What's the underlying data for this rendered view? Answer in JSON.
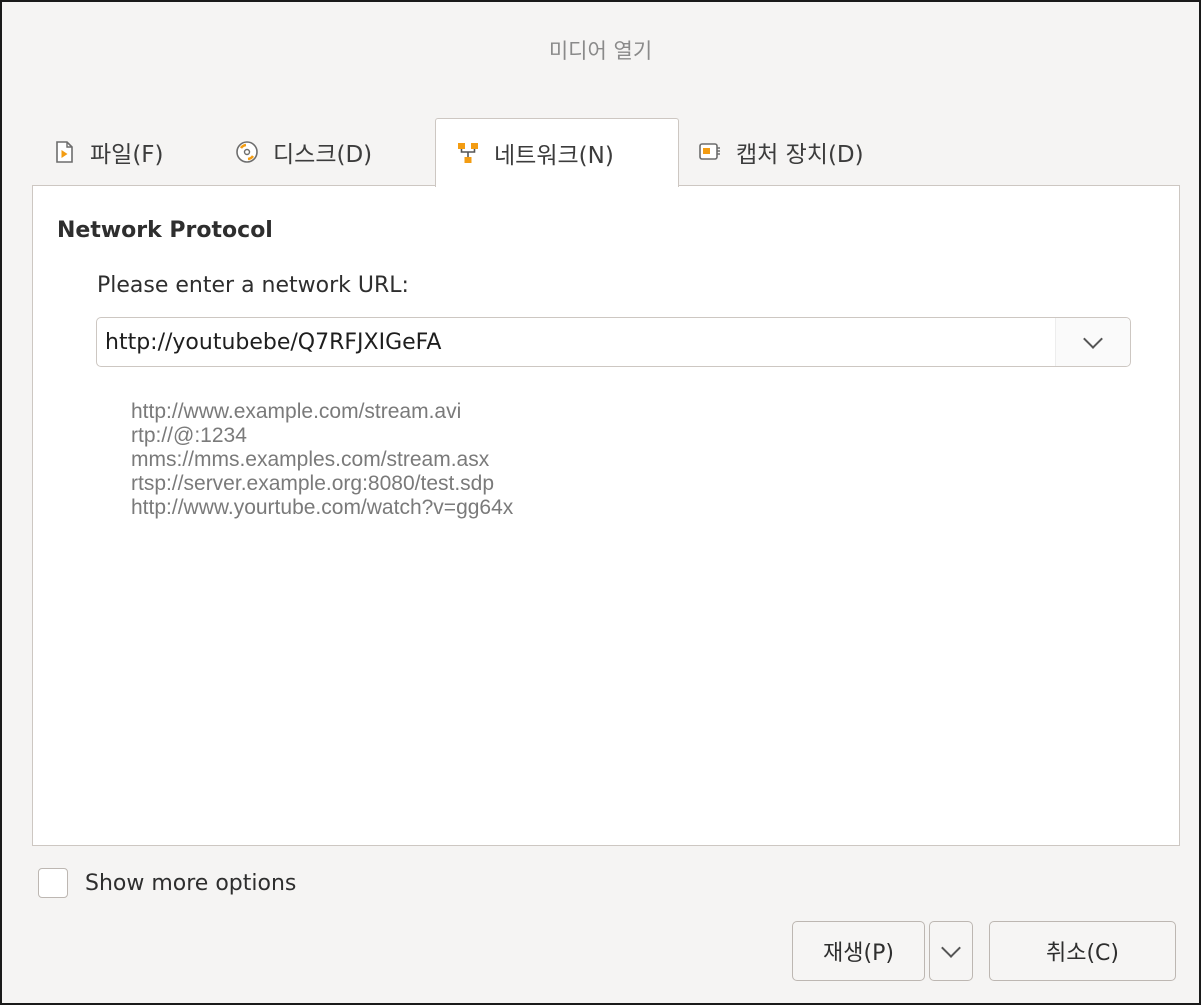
{
  "window": {
    "title": "미디어 열기"
  },
  "tabs": [
    {
      "label": "파일(F)",
      "icon": "file-icon"
    },
    {
      "label": "디스크(D)",
      "icon": "disc-icon"
    },
    {
      "label": "네트워크(N)",
      "icon": "network-icon"
    },
    {
      "label": "캡처 장치(D)",
      "icon": "capture-device-icon"
    }
  ],
  "network": {
    "group_title": "Network Protocol",
    "url_label": "Please enter a network URL:",
    "url_value": "http://youtubebe/Q7RFJXIGeFA",
    "examples": [
      "http://www.example.com/stream.avi",
      "rtp://@:1234",
      "mms://mms.examples.com/stream.asx",
      "rtsp://server.example.org:8080/test.sdp",
      "http://www.yourtube.com/watch?v=gg64x"
    ]
  },
  "options": {
    "show_more_label": "Show more options",
    "show_more_checked": false
  },
  "buttons": {
    "play_label": "재생(P)",
    "cancel_label": "취소(C)"
  },
  "colors": {
    "accent_orange": "#f39c12",
    "window_bg": "#f5f4f3",
    "hint_text": "#7a7a7a"
  }
}
